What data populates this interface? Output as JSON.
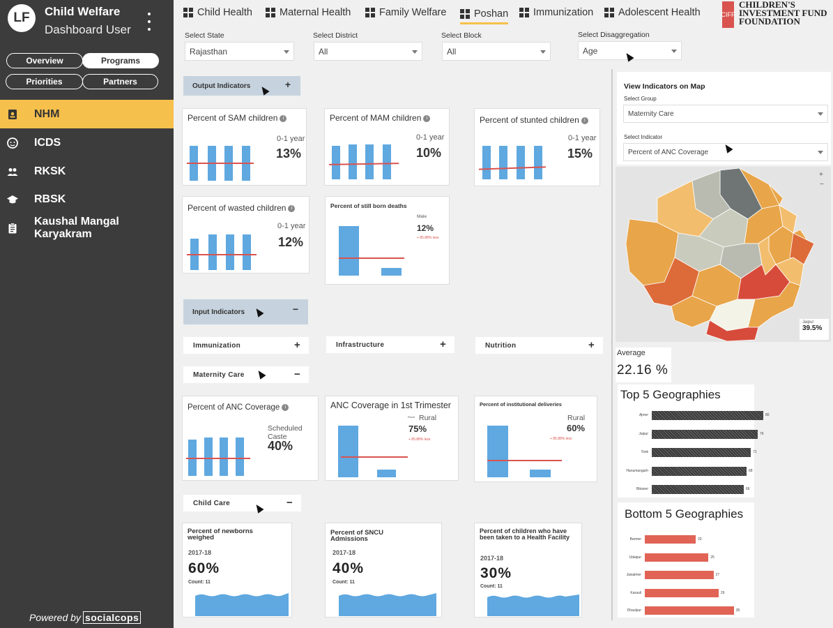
{
  "sidebar": {
    "logo": "LF",
    "user_line1": "Child Welfare",
    "user_line2": "Dashboard User",
    "pills": [
      "Overview",
      "Programs",
      "Priorities",
      "Partners"
    ],
    "items": [
      {
        "label": "NHM",
        "icon": "badge-icon"
      },
      {
        "label": "ICDS",
        "icon": "baby-face-icon"
      },
      {
        "label": "RKSK",
        "icon": "group-icon"
      },
      {
        "label": "RBSK",
        "icon": "school-icon"
      },
      {
        "label": "Kaushal Mangal Karyakram",
        "icon": "clipboard-icon"
      }
    ],
    "powered_by": "Powered by",
    "powered_brand": "socialcops"
  },
  "nav": {
    "tabs": [
      "Child Health",
      "Maternal Health",
      "Family Welfare",
      "Poshan",
      "Immunization",
      "Adolescent Health"
    ],
    "active_tab": "Poshan",
    "brand_mark": "CIFF",
    "brand_line1": "CHILDREN'S",
    "brand_line2": "INVESTMENT FUND",
    "brand_line3": "FOUNDATION"
  },
  "filters": {
    "state": {
      "label": "Select State",
      "value": "Rajasthan"
    },
    "district": {
      "label": "Select District",
      "value": "All"
    },
    "block": {
      "label": "Select Block",
      "value": "All"
    },
    "disaggregation": {
      "label": "Select Disaggregation",
      "value": "Age"
    }
  },
  "output": {
    "header": "Output Indicators",
    "toggle": "+",
    "cards": [
      {
        "title": "Percent of SAM children",
        "sub": "0-1 year",
        "value": "13%"
      },
      {
        "title": "Percent of MAM children",
        "sub": "0-1 year",
        "value": "10%"
      },
      {
        "title": "Percent of stunted children",
        "sub": "0-1 year",
        "value": "15%"
      },
      {
        "title": "Percent of wasted children",
        "sub": "0-1 year",
        "value": "12%"
      },
      {
        "title": "Percent of still born deaths",
        "sub": "Male",
        "value": "12%",
        "note": "+ 85.88% less"
      }
    ]
  },
  "input": {
    "header": "Input Indicators",
    "toggle": "−",
    "subsections": [
      {
        "label": "Immunization",
        "toggle": "+"
      },
      {
        "label": "Infrastructure",
        "toggle": "+"
      },
      {
        "label": "Nutrition",
        "toggle": "+"
      },
      {
        "label": "Maternity Care",
        "toggle": "−"
      },
      {
        "label": "Child Care",
        "toggle": "−"
      }
    ],
    "maternity_cards": [
      {
        "title": "Percent of ANC Coverage",
        "sub": "Scheduled Caste",
        "value": "40%"
      },
      {
        "title": "ANC Coverage in 1st Trimester",
        "sub": "Rural",
        "value": "75%",
        "note": "+ 85.88% less",
        "mini": "Rural"
      },
      {
        "title": "Percent of institutional deliveries",
        "sub": "Rural",
        "value": "60%",
        "note": "+ 85.88% less"
      }
    ],
    "child_cards": [
      {
        "title": "Percent of newborns weighed",
        "year": "2017-18",
        "value": "60%",
        "count": "Count: 11"
      },
      {
        "title": "Percent of SNCU Admissions",
        "year": "2017-18",
        "value": "40%",
        "count": "Count: 11"
      },
      {
        "title": "Percent of children who have been taken to a Health Facility",
        "year": "2017-18",
        "value": "30%",
        "count": "Count: 11"
      }
    ]
  },
  "map_panel": {
    "title": "View Indicators on Map",
    "group_label": "Select Group",
    "group_value": "Maternity Care",
    "indicator_label": "Select Indicator",
    "indicator_value": "Percent of ANC Coverage",
    "zoom_in": "+",
    "zoom_out": "−",
    "tooltip_name": "Jaipur",
    "tooltip_value": "39.5%",
    "average_label": "Average",
    "average_value": "22.16 %"
  },
  "chart_data": [
    {
      "type": "bar",
      "title": "Top 5 Geographies",
      "orientation": "horizontal",
      "categories": [
        "Ajmer",
        "Jaipur",
        "Tonk",
        "Hanumangarh",
        "Bikaner"
      ],
      "values": [
        80,
        76,
        71,
        68,
        66
      ],
      "xlim": [
        0,
        90
      ],
      "color": "#3a3a3a"
    },
    {
      "type": "bar",
      "title": "Bottom 5 Geographies",
      "orientation": "horizontal",
      "categories": [
        "Barmer",
        "Udaipur",
        "Jaisalmer",
        "Karauli",
        "Dhaulpur"
      ],
      "values": [
        20,
        25,
        27,
        29,
        35
      ],
      "xlim": [
        0,
        40
      ],
      "color": "#e06356"
    }
  ]
}
